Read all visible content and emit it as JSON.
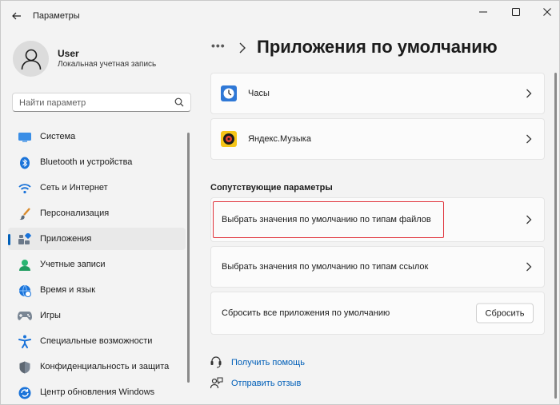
{
  "window": {
    "title": "Параметры"
  },
  "account": {
    "name": "User",
    "type": "Локальная учетная запись"
  },
  "search": {
    "placeholder": "Найти параметр"
  },
  "sidebar": {
    "items": [
      {
        "label": "Система",
        "icon": "system-icon"
      },
      {
        "label": "Bluetooth и устройства",
        "icon": "bluetooth-icon"
      },
      {
        "label": "Сеть и Интернет",
        "icon": "wifi-icon"
      },
      {
        "label": "Персонализация",
        "icon": "brush-icon"
      },
      {
        "label": "Приложения",
        "icon": "apps-icon",
        "active": true
      },
      {
        "label": "Учетные записи",
        "icon": "accounts-icon"
      },
      {
        "label": "Время и язык",
        "icon": "globe-clock-icon"
      },
      {
        "label": "Игры",
        "icon": "gamepad-icon"
      },
      {
        "label": "Специальные возможности",
        "icon": "accessibility-icon"
      },
      {
        "label": "Конфиденциальность и защита",
        "icon": "shield-icon"
      },
      {
        "label": "Центр обновления Windows",
        "icon": "update-icon"
      }
    ]
  },
  "header": {
    "breadcrumb_more": "•••",
    "title": "Приложения по умолчанию"
  },
  "apps": [
    {
      "label": "Часы",
      "icon": "clock-app-icon"
    },
    {
      "label": "Яндекс.Музыка",
      "icon": "yandex-music-icon"
    }
  ],
  "related": {
    "title": "Сопутствующие параметры",
    "by_file_type": "Выбрать значения по умолчанию по типам файлов",
    "by_link_type": "Выбрать значения по умолчанию по типам ссылок",
    "reset_label": "Сбросить все приложения по умолчанию",
    "reset_button": "Сбросить"
  },
  "help": {
    "get_help": "Получить помощь",
    "feedback": "Отправить отзыв"
  },
  "colors": {
    "accent": "#005fb8",
    "highlight": "#e0343c"
  }
}
